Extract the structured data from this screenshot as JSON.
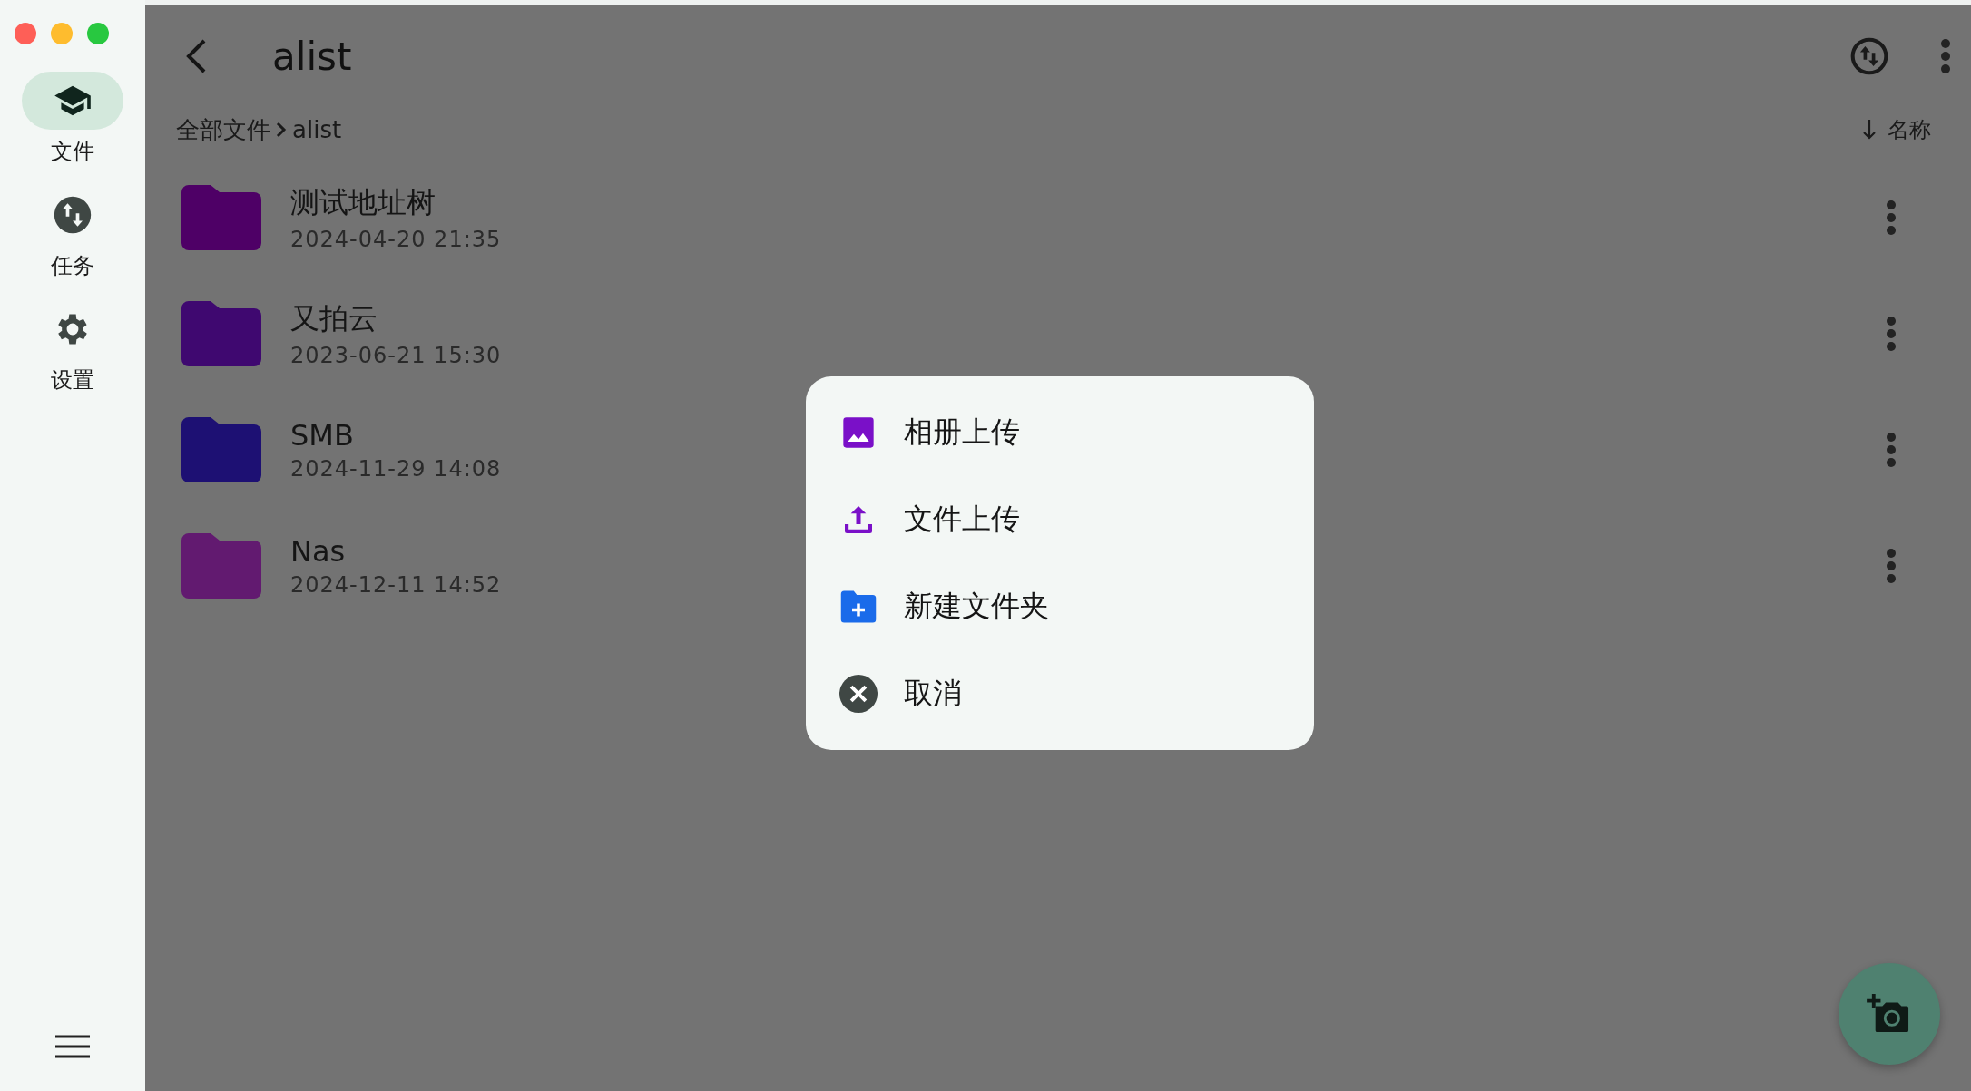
{
  "sidebar": {
    "items": [
      {
        "kind": "files",
        "label": "文件",
        "selected": true
      },
      {
        "kind": "tasks",
        "label": "任务",
        "selected": false
      },
      {
        "kind": "settings",
        "label": "设置",
        "selected": false
      }
    ]
  },
  "top_bar": {
    "title": "alist"
  },
  "breadcrumb": [
    "全部文件",
    "alist"
  ],
  "sort": {
    "label": "名称"
  },
  "files": [
    {
      "name": "测试地址树",
      "date": "2024-04-20 21:35",
      "color": "#4e0066"
    },
    {
      "name": "又拍云",
      "date": "2023-06-21 15:30",
      "color": "#3f0870"
    },
    {
      "name": "SMB",
      "date": "2024-11-29 14:08",
      "color": "#1d1073"
    },
    {
      "name": "Nas",
      "date": "2024-12-11 14:52",
      "color": "#621a70"
    }
  ],
  "menu": [
    {
      "kind": "album",
      "label": "相册上传"
    },
    {
      "kind": "upload",
      "label": "文件上传"
    },
    {
      "kind": "new_folder",
      "label": "新建文件夹"
    },
    {
      "kind": "cancel",
      "label": "取消"
    }
  ]
}
